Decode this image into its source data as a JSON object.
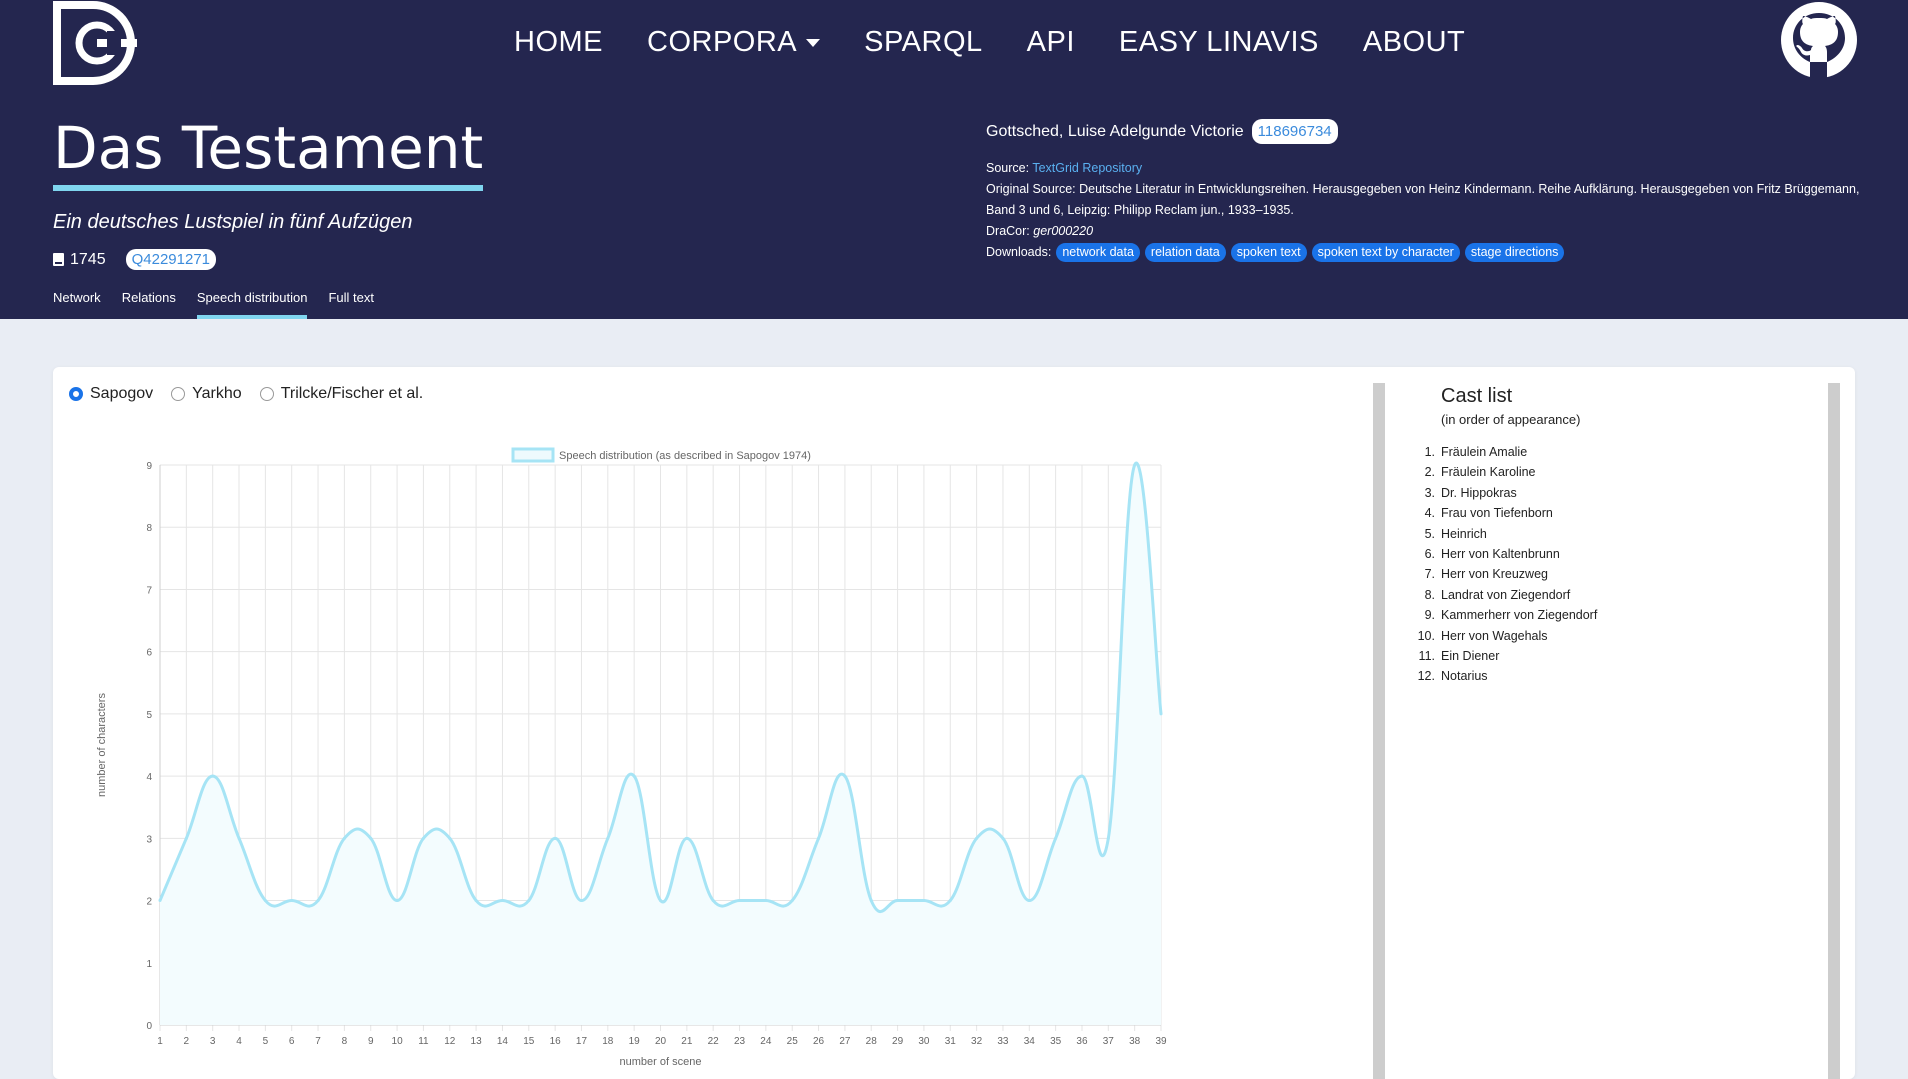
{
  "nav": {
    "items": [
      {
        "label": "HOME"
      },
      {
        "label": "CORPORA"
      },
      {
        "label": "SPARQL"
      },
      {
        "label": "API"
      },
      {
        "label": "EASY LINAVIS"
      },
      {
        "label": "ABOUT"
      }
    ]
  },
  "play": {
    "title": "Das Testament",
    "subtitle": "Ein deutsches Lustspiel in fünf Aufzügen",
    "year": "1745",
    "wikidata": "Q42291271"
  },
  "tabs": [
    {
      "label": "Network"
    },
    {
      "label": "Relations"
    },
    {
      "label": "Speech distribution"
    },
    {
      "label": "Full text"
    }
  ],
  "author": {
    "name": "Gottsched, Luise Adelgunde Victorie",
    "gnd": "118696734"
  },
  "source": {
    "label": "Source:",
    "link": "TextGrid Repository",
    "original_label": "Original Source:",
    "original": "Deutsche Literatur in Entwicklungsreihen. Herausgegeben von Heinz Kindermann. Reihe Aufklärung. Herausgegeben von Fritz Brüggemann, Band 3 und 6, Leipzig: Philipp Reclam jun., 1933–1935.",
    "dracor_label": "DraCor:",
    "dracor_id": "ger000220"
  },
  "downloads": {
    "label": "Downloads:",
    "items": [
      "network data",
      "relation data",
      "spoken text",
      "spoken text by character",
      "stage directions"
    ]
  },
  "radios": [
    {
      "label": "Sapogov",
      "selected": true
    },
    {
      "label": "Yarkho",
      "selected": false
    },
    {
      "label": "Trilcke/Fischer et al.",
      "selected": false
    }
  ],
  "chart_data": {
    "type": "line",
    "legend": "Speech distribution (as described in Sapogov 1974)",
    "xlabel": "number of scene",
    "ylabel": "number of characters",
    "x": [
      1,
      2,
      3,
      4,
      5,
      6,
      7,
      8,
      9,
      10,
      11,
      12,
      13,
      14,
      15,
      16,
      17,
      18,
      19,
      20,
      21,
      22,
      23,
      24,
      25,
      26,
      27,
      28,
      29,
      30,
      31,
      32,
      33,
      34,
      35,
      36,
      37,
      38,
      39
    ],
    "values": [
      2,
      3,
      4,
      3,
      2,
      2,
      2,
      3,
      3,
      2,
      3,
      3,
      2,
      2,
      2,
      3,
      2,
      3,
      4,
      2,
      3,
      2,
      2,
      2,
      2,
      3,
      4,
      2,
      2,
      2,
      2,
      3,
      3,
      2,
      3,
      4,
      3,
      9,
      5
    ],
    "ylim": [
      0,
      9
    ],
    "yticks": [
      0,
      1,
      2,
      3,
      4,
      5,
      6,
      7,
      8,
      9
    ],
    "grid": true,
    "legend_position": "top",
    "color": "#a6e4f5"
  },
  "cast": {
    "title": "Cast list",
    "subtitle": "(in order of appearance)",
    "members": [
      "Fräulein Amalie",
      "Fräulein Karoline",
      "Dr. Hippokras",
      "Frau von Tiefenborn",
      "Heinrich",
      "Herr von Kaltenbrunn",
      "Herr von Kreuzweg",
      "Landrat von Ziegendorf",
      "Kammerherr von Ziegendorf",
      "Herr von Wagehals",
      "Ein Diener",
      "Notarius"
    ]
  }
}
